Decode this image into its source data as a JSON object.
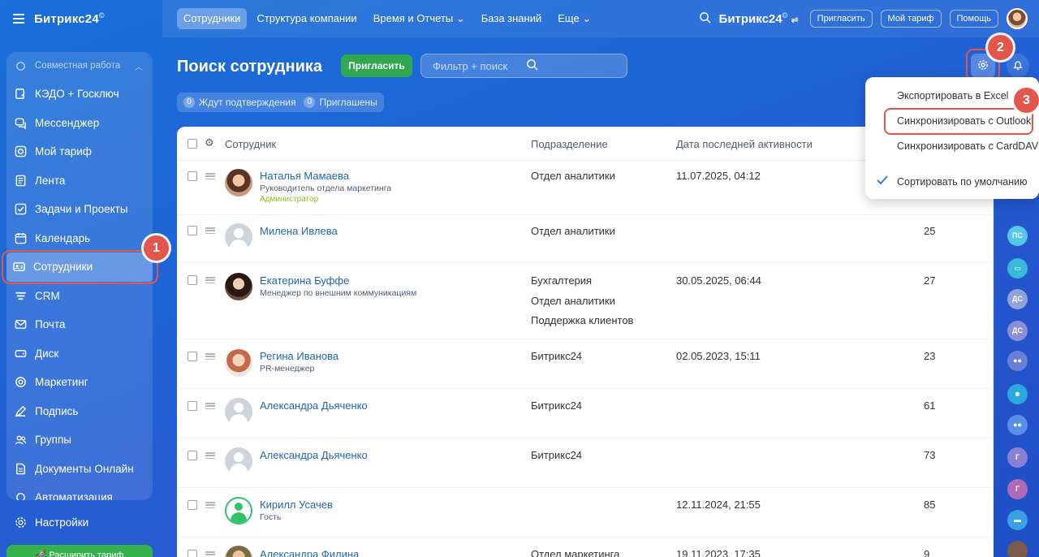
{
  "brand": {
    "name": "Битрикс24",
    "mark": "©"
  },
  "sidebar": {
    "group_label": "Совместная работа",
    "items": [
      {
        "label": "КЭДО + Госключ",
        "icon": "kedo-icon"
      },
      {
        "label": "Мессенджер",
        "icon": "messenger-icon"
      },
      {
        "label": "Мой тариф",
        "icon": "tariff-icon"
      },
      {
        "label": "Лента",
        "icon": "feed-icon"
      },
      {
        "label": "Задачи и Проекты",
        "icon": "tasks-icon"
      },
      {
        "label": "Календарь",
        "icon": "calendar-icon"
      },
      {
        "label": "Сотрудники",
        "icon": "employees-icon",
        "active": true
      },
      {
        "label": "CRM",
        "icon": "crm-icon"
      },
      {
        "label": "Почта",
        "icon": "mail-icon"
      },
      {
        "label": "Диск",
        "icon": "disk-icon"
      },
      {
        "label": "Маркетинг",
        "icon": "marketing-icon"
      },
      {
        "label": "Подпись",
        "icon": "signature-icon"
      },
      {
        "label": "Группы",
        "icon": "groups-icon"
      },
      {
        "label": "Документы Онлайн",
        "icon": "documents-icon"
      },
      {
        "label": "Автоматизация",
        "icon": "automation-icon"
      }
    ],
    "settings_label": "Настройки",
    "upgrade_label": "Расширить тариф"
  },
  "topbar": {
    "tabs": [
      {
        "label": "Сотрудники",
        "active": true
      },
      {
        "label": "Структура компании"
      },
      {
        "label": "Время и Отчеты",
        "dropdown": true
      },
      {
        "label": "База знаний"
      },
      {
        "label": "Еще",
        "dropdown": true
      }
    ],
    "brand": "Битрикс24",
    "invite": "Пригласить",
    "tariff": "Мой тариф",
    "help": "Помощь"
  },
  "page": {
    "title": "Поиск сотрудника",
    "invite_button": "Пригласить",
    "search_placeholder": "Фильтр + поиск",
    "counters": [
      {
        "count": "0",
        "label": "Ждут подтверждения"
      },
      {
        "count": "0",
        "label": "Приглашены"
      }
    ]
  },
  "table": {
    "columns": {
      "employee": "Сотрудник",
      "department": "Подразделение",
      "last_activity": "Дата последней активности"
    },
    "rows": [
      {
        "name": "Наталья Мамаева",
        "position": "Руководитель отдела маркетинга",
        "role": "Администратор",
        "departments": [
          "Отдел аналитики"
        ],
        "date": "11.07.2025, 04:12",
        "num": ""
      },
      {
        "name": "Милена Ивлева",
        "position": "",
        "role": "",
        "departments": [
          "Отдел аналитики"
        ],
        "date": "",
        "num": "25"
      },
      {
        "name": "Екатерина Буффе",
        "position": "Менеджер по внешним коммуникациям",
        "role": "",
        "departments": [
          "Бухгалтерия",
          "Отдел аналитики",
          "Поддержка клиентов"
        ],
        "date": "30.05.2025, 06:44",
        "num": "27"
      },
      {
        "name": "Регина Иванова",
        "position": "PR-менеджер",
        "role": "",
        "departments": [
          "Битрикс24"
        ],
        "date": "02.05.2023, 15:11",
        "num": "23"
      },
      {
        "name": "Александра Дьяченко",
        "position": "",
        "role": "",
        "departments": [
          "Битрикс24"
        ],
        "date": "",
        "num": "61"
      },
      {
        "name": "Александра Дьяченко",
        "position": "",
        "role": "",
        "departments": [
          "Битрикс24"
        ],
        "date": "",
        "num": "73"
      },
      {
        "name": "Кирилл Усачев",
        "position": "Гость",
        "role": "",
        "departments": [],
        "date": "12.11.2024, 21:55",
        "num": "85"
      },
      {
        "name": "Александра Филина",
        "position": "",
        "role": "",
        "departments": [
          "Отдел маркетинга"
        ],
        "date": "19.11.2023, 17:35",
        "num": "9"
      }
    ]
  },
  "dropdown": {
    "items": [
      {
        "label": "Экспортировать в Excel"
      },
      {
        "label": "Синхронизировать с Outlook"
      },
      {
        "label": "Синхронизировать с CardDAV"
      },
      {
        "label": "Сортировать по умолчанию",
        "checked": true
      }
    ]
  },
  "rail": [
    "ПС",
    "ДС",
    "ДС",
    "Г",
    "Г"
  ],
  "callouts": [
    "1",
    "2",
    "3"
  ],
  "colors": {
    "accent_green": "#2fa84f",
    "callout_red": "#e3564c",
    "link_blue": "#2067b0"
  }
}
